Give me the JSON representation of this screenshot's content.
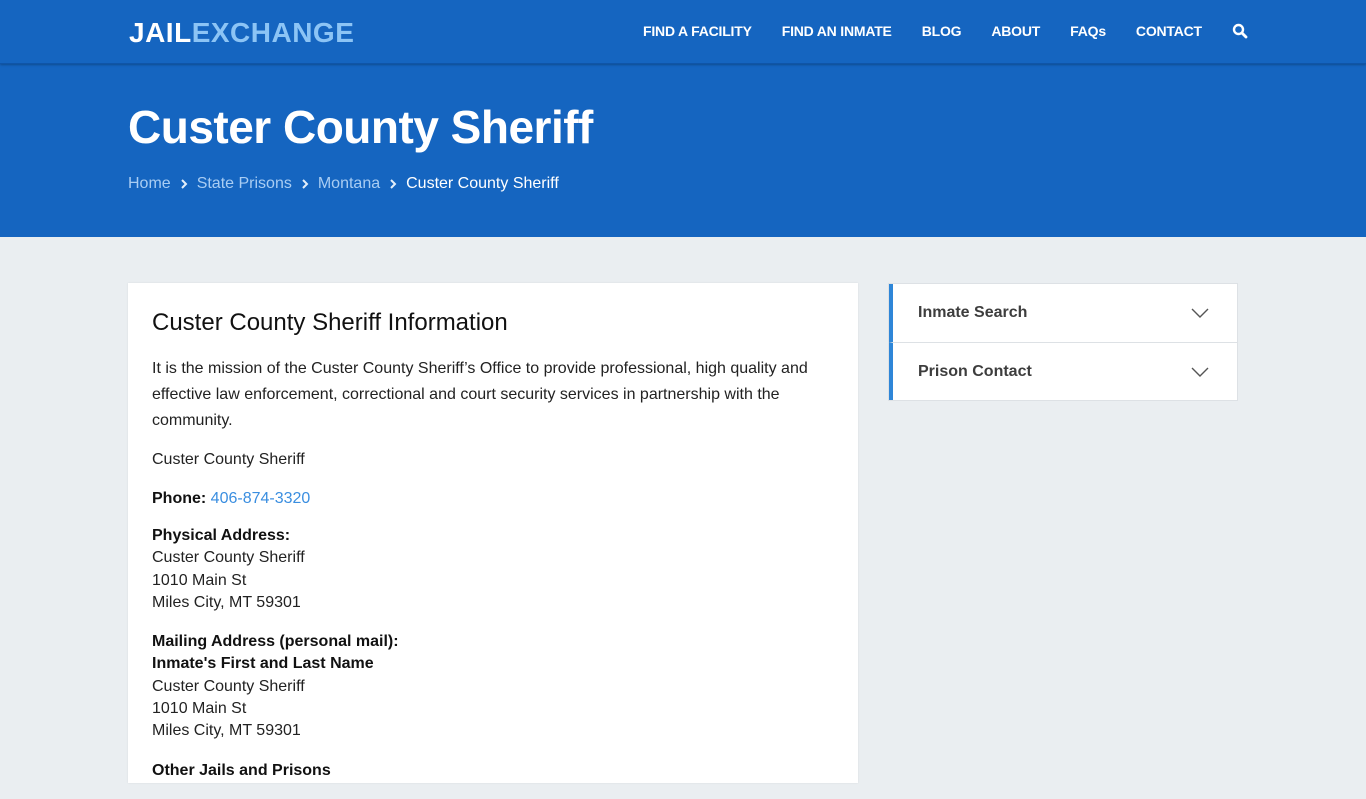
{
  "logo": {
    "part1": "JAIL",
    "part2": "EXCHANGE"
  },
  "nav": {
    "items": [
      {
        "label": "FIND A FACILITY"
      },
      {
        "label": "FIND AN INMATE"
      },
      {
        "label": "BLOG"
      },
      {
        "label": "ABOUT"
      },
      {
        "label": "FAQs"
      },
      {
        "label": "CONTACT"
      }
    ],
    "search_icon": "search-icon"
  },
  "hero": {
    "title": "Custer County Sheriff",
    "breadcrumb": [
      {
        "label": "Home"
      },
      {
        "label": "State Prisons"
      },
      {
        "label": "Montana"
      },
      {
        "label": "Custer County Sheriff"
      }
    ]
  },
  "main": {
    "heading": "Custer County Sheriff Information",
    "mission": "It is the mission of the Custer County Sheriff’s Office to provide professional, high quality and effective law enforcement, correctional and court security services in partnership with the community.",
    "facility_name": "Custer County Sheriff",
    "phone_label": "Phone:",
    "phone": "406-874-3320",
    "physical_address": {
      "label": "Physical Address:",
      "line1": "Custer County Sheriff",
      "line2": "1010 Main St",
      "line3": "Miles City, MT 59301"
    },
    "mailing_address": {
      "label": "Mailing Address (personal mail):",
      "recipient": "Inmate's First and Last Name",
      "line1": "Custer County Sheriff",
      "line2": "1010 Main St",
      "line3": "Miles City, MT 59301"
    },
    "other_heading": "Other Jails and Prisons"
  },
  "sidebar": {
    "items": [
      {
        "label": "Inmate Search"
      },
      {
        "label": "Prison Contact"
      }
    ]
  },
  "colors": {
    "brand_blue": "#1565c0",
    "logo_accent": "#8cc4f5",
    "link_blue": "#3a8ee0",
    "accordion_accent": "#2e86d8",
    "page_bg": "#eaeef1"
  }
}
